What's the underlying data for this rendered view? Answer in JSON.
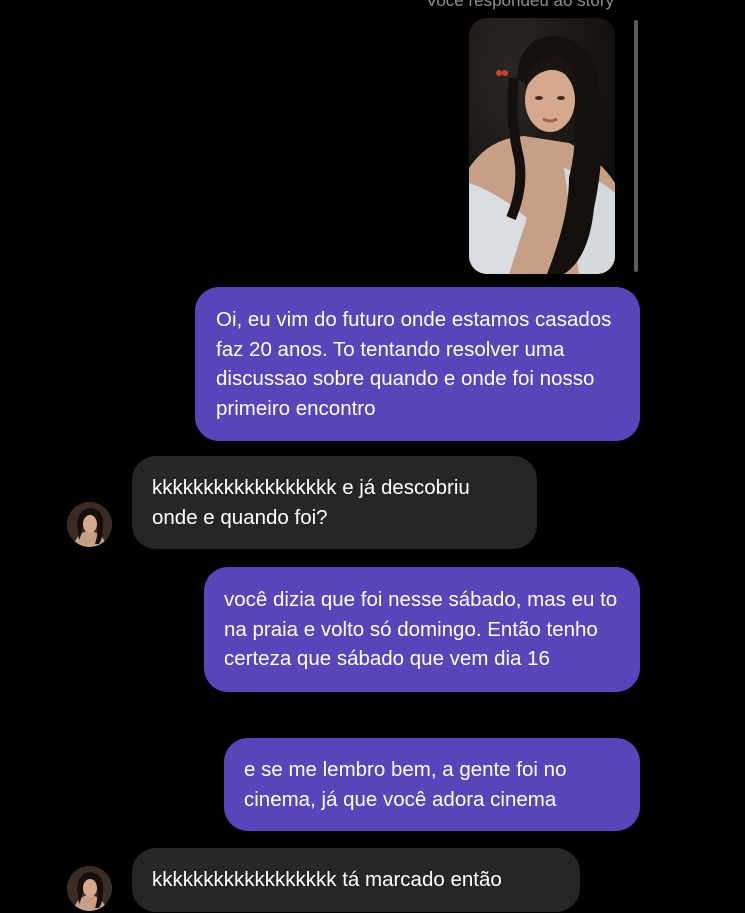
{
  "conversation": {
    "replied_note": "Você respondeu ao story",
    "messages": [
      {
        "from": "me",
        "text": "Oi, eu vim do futuro onde estamos casados faz 20 anos. To tentando resolver uma discussao sobre quando e onde foi nosso primeiro encontro"
      },
      {
        "from": "other",
        "text": "kkkkkkkkkkkkkkkkkk e já descobriu onde e quando foi?"
      },
      {
        "from": "me",
        "text": "você dizia que foi nesse sábado, mas eu to na praia e volto só domingo. Então tenho certeza que sábado que vem dia 16"
      },
      {
        "from": "me",
        "text": "e se me lembro bem, a gente foi no cinema, já que você adora cinema"
      },
      {
        "from": "other",
        "text": "kkkkkkkkkkkkkkkkkk tá marcado então"
      }
    ]
  },
  "colors": {
    "background": "#000000",
    "outgoing_bubble": "#5a44b9",
    "incoming_bubble": "#262626",
    "text": "#ffffff",
    "muted_text": "#8e8e8e"
  },
  "icons": {
    "avatar": "contact-avatar",
    "story": "story-photo"
  }
}
